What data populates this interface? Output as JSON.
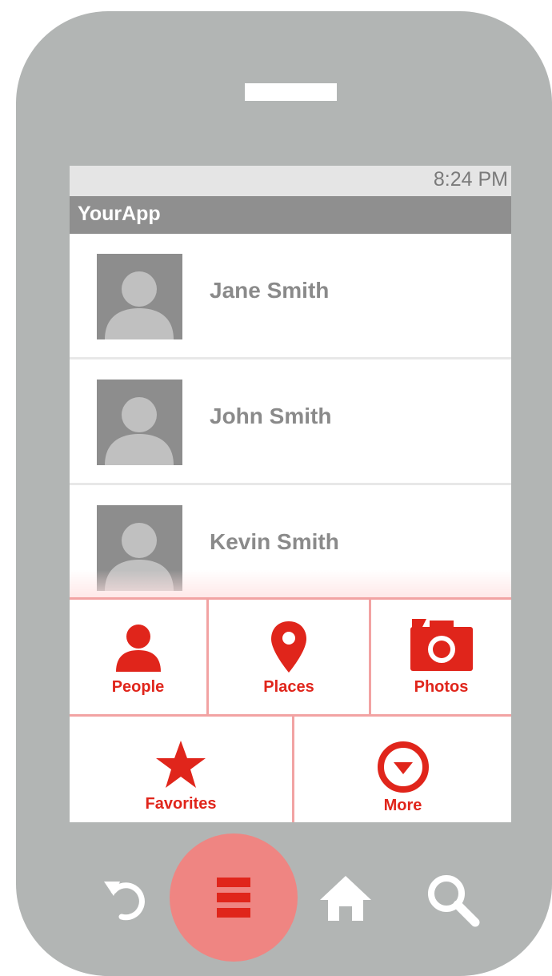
{
  "status_bar": {
    "time": "8:24 PM"
  },
  "app_bar": {
    "title": "YourApp"
  },
  "contacts": [
    {
      "name": "Jane Smith",
      "icon": "person-avatar-icon"
    },
    {
      "name": "John Smith",
      "icon": "person-avatar-icon"
    },
    {
      "name": "Kevin Smith",
      "icon": "person-avatar-icon"
    }
  ],
  "menu": [
    {
      "label": "People",
      "icon": "person-icon"
    },
    {
      "label": "Places",
      "icon": "map-pin-icon"
    },
    {
      "label": "Photos",
      "icon": "camera-icon"
    },
    {
      "label": "Favorites",
      "icon": "star-icon"
    },
    {
      "label": "More",
      "icon": "chevron-down-circle-icon"
    }
  ],
  "nav_buttons": [
    {
      "icon": "back-icon"
    },
    {
      "icon": "menu-icon"
    },
    {
      "icon": "home-icon"
    },
    {
      "icon": "search-icon"
    }
  ],
  "colors": {
    "accent": "#e0251b",
    "phone_body": "#b2b5b4",
    "menu_button": "#ef8582",
    "app_bar": "#8f8f8f",
    "avatar": "#8d8d8d"
  }
}
